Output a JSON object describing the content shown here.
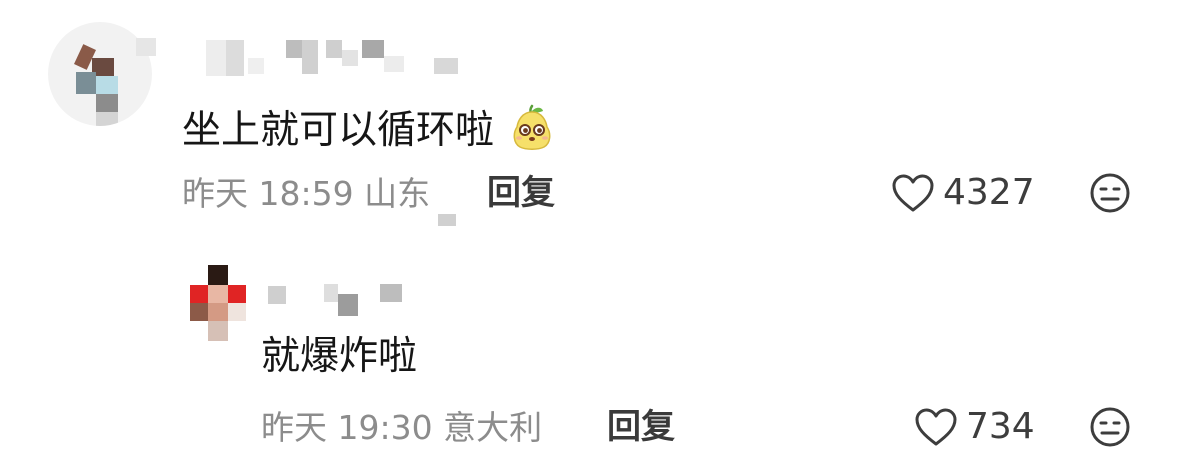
{
  "comments": [
    {
      "text": "坐上就可以循环啦",
      "emoji": "pear-face-emoji",
      "time": "昨天 18:59",
      "location": "山东",
      "reply_label": "回复",
      "likes": "4327",
      "icons": {
        "like": "heart-outline-icon",
        "dislike": "meh-face-icon"
      }
    },
    {
      "text": "就爆炸啦",
      "time": "昨天 19:30",
      "location": "意大利",
      "reply_label": "回复",
      "likes": "734",
      "icons": {
        "like": "heart-outline-icon",
        "dislike": "meh-face-icon"
      }
    }
  ],
  "colors": {
    "text": "#161616",
    "meta": "#8c8c8c",
    "action": "#3a3a3a",
    "background": "#ffffff"
  }
}
